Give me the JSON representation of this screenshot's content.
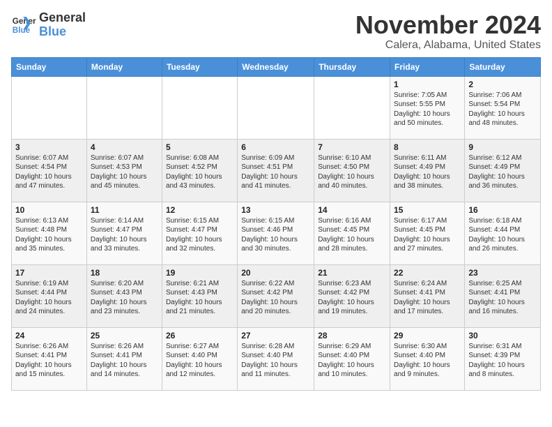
{
  "logo": {
    "name_part1": "General",
    "name_part2": "Blue"
  },
  "title": "November 2024",
  "subtitle": "Calera, Alabama, United States",
  "weekdays": [
    "Sunday",
    "Monday",
    "Tuesday",
    "Wednesday",
    "Thursday",
    "Friday",
    "Saturday"
  ],
  "weeks": [
    [
      {
        "day": "",
        "info": ""
      },
      {
        "day": "",
        "info": ""
      },
      {
        "day": "",
        "info": ""
      },
      {
        "day": "",
        "info": ""
      },
      {
        "day": "",
        "info": ""
      },
      {
        "day": "1",
        "info": "Sunrise: 7:05 AM\nSunset: 5:55 PM\nDaylight: 10 hours and 50 minutes."
      },
      {
        "day": "2",
        "info": "Sunrise: 7:06 AM\nSunset: 5:54 PM\nDaylight: 10 hours and 48 minutes."
      }
    ],
    [
      {
        "day": "3",
        "info": "Sunrise: 6:07 AM\nSunset: 4:54 PM\nDaylight: 10 hours and 47 minutes."
      },
      {
        "day": "4",
        "info": "Sunrise: 6:07 AM\nSunset: 4:53 PM\nDaylight: 10 hours and 45 minutes."
      },
      {
        "day": "5",
        "info": "Sunrise: 6:08 AM\nSunset: 4:52 PM\nDaylight: 10 hours and 43 minutes."
      },
      {
        "day": "6",
        "info": "Sunrise: 6:09 AM\nSunset: 4:51 PM\nDaylight: 10 hours and 41 minutes."
      },
      {
        "day": "7",
        "info": "Sunrise: 6:10 AM\nSunset: 4:50 PM\nDaylight: 10 hours and 40 minutes."
      },
      {
        "day": "8",
        "info": "Sunrise: 6:11 AM\nSunset: 4:49 PM\nDaylight: 10 hours and 38 minutes."
      },
      {
        "day": "9",
        "info": "Sunrise: 6:12 AM\nSunset: 4:49 PM\nDaylight: 10 hours and 36 minutes."
      }
    ],
    [
      {
        "day": "10",
        "info": "Sunrise: 6:13 AM\nSunset: 4:48 PM\nDaylight: 10 hours and 35 minutes."
      },
      {
        "day": "11",
        "info": "Sunrise: 6:14 AM\nSunset: 4:47 PM\nDaylight: 10 hours and 33 minutes."
      },
      {
        "day": "12",
        "info": "Sunrise: 6:15 AM\nSunset: 4:47 PM\nDaylight: 10 hours and 32 minutes."
      },
      {
        "day": "13",
        "info": "Sunrise: 6:15 AM\nSunset: 4:46 PM\nDaylight: 10 hours and 30 minutes."
      },
      {
        "day": "14",
        "info": "Sunrise: 6:16 AM\nSunset: 4:45 PM\nDaylight: 10 hours and 28 minutes."
      },
      {
        "day": "15",
        "info": "Sunrise: 6:17 AM\nSunset: 4:45 PM\nDaylight: 10 hours and 27 minutes."
      },
      {
        "day": "16",
        "info": "Sunrise: 6:18 AM\nSunset: 4:44 PM\nDaylight: 10 hours and 26 minutes."
      }
    ],
    [
      {
        "day": "17",
        "info": "Sunrise: 6:19 AM\nSunset: 4:44 PM\nDaylight: 10 hours and 24 minutes."
      },
      {
        "day": "18",
        "info": "Sunrise: 6:20 AM\nSunset: 4:43 PM\nDaylight: 10 hours and 23 minutes."
      },
      {
        "day": "19",
        "info": "Sunrise: 6:21 AM\nSunset: 4:43 PM\nDaylight: 10 hours and 21 minutes."
      },
      {
        "day": "20",
        "info": "Sunrise: 6:22 AM\nSunset: 4:42 PM\nDaylight: 10 hours and 20 minutes."
      },
      {
        "day": "21",
        "info": "Sunrise: 6:23 AM\nSunset: 4:42 PM\nDaylight: 10 hours and 19 minutes."
      },
      {
        "day": "22",
        "info": "Sunrise: 6:24 AM\nSunset: 4:41 PM\nDaylight: 10 hours and 17 minutes."
      },
      {
        "day": "23",
        "info": "Sunrise: 6:25 AM\nSunset: 4:41 PM\nDaylight: 10 hours and 16 minutes."
      }
    ],
    [
      {
        "day": "24",
        "info": "Sunrise: 6:26 AM\nSunset: 4:41 PM\nDaylight: 10 hours and 15 minutes."
      },
      {
        "day": "25",
        "info": "Sunrise: 6:26 AM\nSunset: 4:41 PM\nDaylight: 10 hours and 14 minutes."
      },
      {
        "day": "26",
        "info": "Sunrise: 6:27 AM\nSunset: 4:40 PM\nDaylight: 10 hours and 12 minutes."
      },
      {
        "day": "27",
        "info": "Sunrise: 6:28 AM\nSunset: 4:40 PM\nDaylight: 10 hours and 11 minutes."
      },
      {
        "day": "28",
        "info": "Sunrise: 6:29 AM\nSunset: 4:40 PM\nDaylight: 10 hours and 10 minutes."
      },
      {
        "day": "29",
        "info": "Sunrise: 6:30 AM\nSunset: 4:40 PM\nDaylight: 10 hours and 9 minutes."
      },
      {
        "day": "30",
        "info": "Sunrise: 6:31 AM\nSunset: 4:39 PM\nDaylight: 10 hours and 8 minutes."
      }
    ]
  ]
}
